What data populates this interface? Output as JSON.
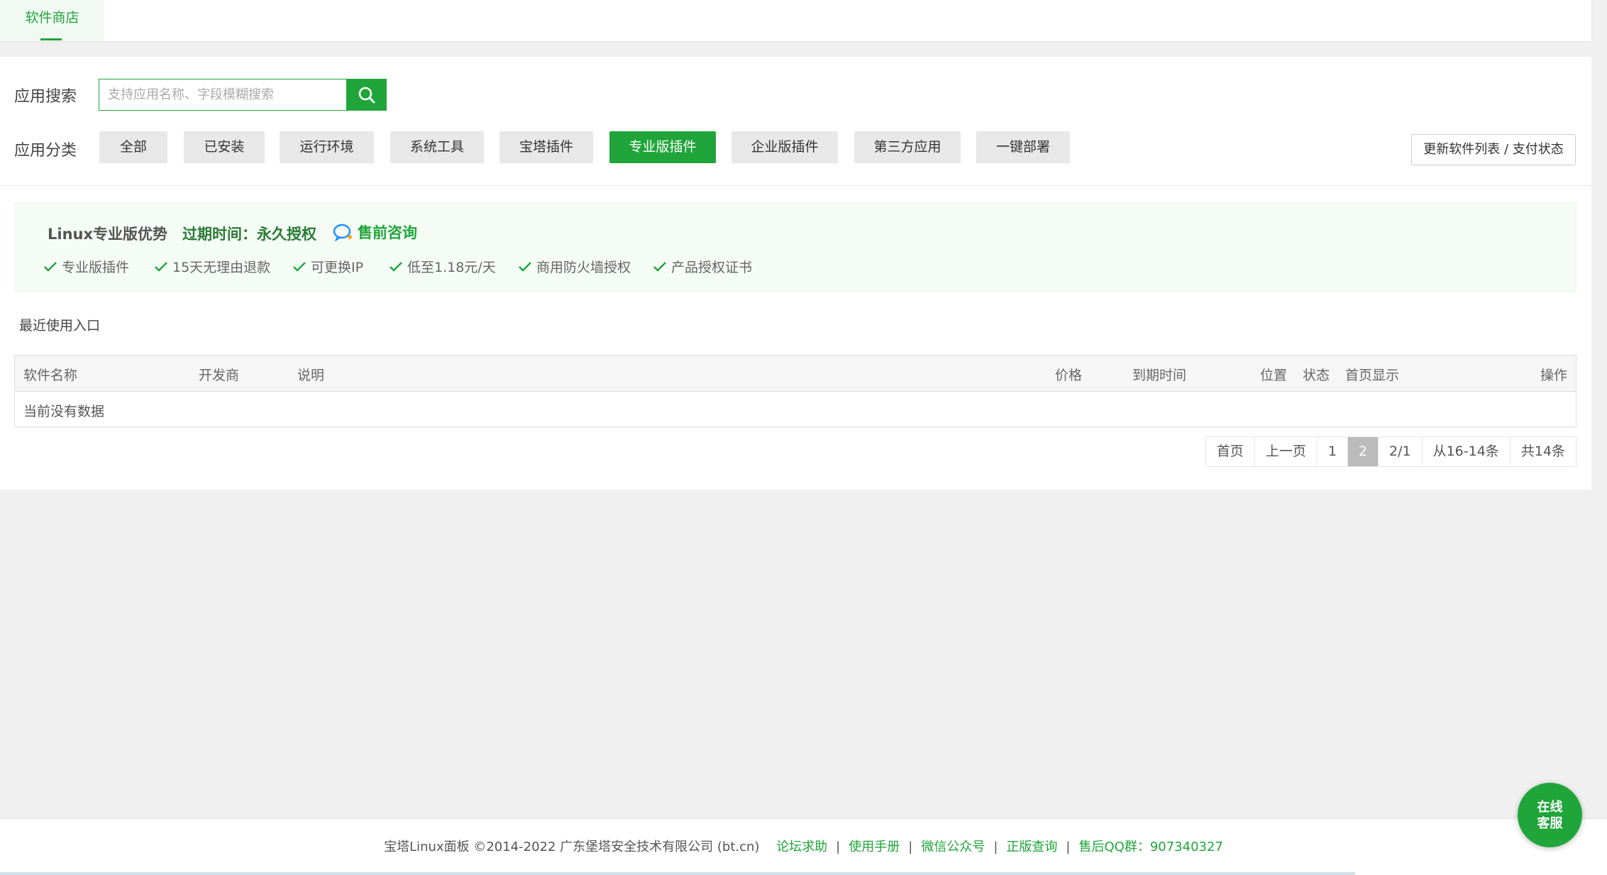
{
  "top_tab": {
    "label": "软件商店"
  },
  "search": {
    "label": "应用搜索",
    "placeholder": "支持应用名称、字段模糊搜索",
    "button_icon": "search-icon"
  },
  "categories": {
    "label": "应用分类",
    "items": [
      {
        "label": "全部",
        "active": false
      },
      {
        "label": "已安装",
        "active": false
      },
      {
        "label": "运行环境",
        "active": false
      },
      {
        "label": "系统工具",
        "active": false
      },
      {
        "label": "宝塔插件",
        "active": false
      },
      {
        "label": "专业版插件",
        "active": true
      },
      {
        "label": "企业版插件",
        "active": false
      },
      {
        "label": "第三方应用",
        "active": false
      },
      {
        "label": "一键部署",
        "active": false
      }
    ]
  },
  "refresh_button": {
    "label": "更新软件列表 / 支付状态"
  },
  "promo": {
    "title": "Linux专业版优势",
    "expire": "过期时间：永久授权",
    "consult": "售前咨询",
    "features": [
      "专业版插件",
      "15天无理由退款",
      "可更换IP",
      "低至1.18元/天",
      "商用防火墙授权",
      "产品授权证书"
    ]
  },
  "recent": {
    "label": "最近使用入口"
  },
  "table": {
    "columns": [
      "软件名称",
      "开发商",
      "说明",
      "价格",
      "到期时间",
      "位置",
      "状态",
      "首页显示",
      "操作"
    ],
    "empty_text": "当前没有数据"
  },
  "pagination": {
    "first": "首页",
    "prev": "上一页",
    "pages": [
      "1",
      "2"
    ],
    "current": "2",
    "page_info": "2/1",
    "range": "从16-14条",
    "total": "共14条"
  },
  "footer": {
    "copyright": "宝塔Linux面板 ©2014-2022 广东堡塔安全技术有限公司 (bt.cn)",
    "links": [
      "论坛求助",
      "使用手册",
      "微信公众号",
      "正版查询"
    ],
    "qq": "售后QQ群：907340327",
    "separator": "|"
  },
  "chat": {
    "line1": "在线",
    "line2": "客服"
  },
  "colors": {
    "accent": "#20a53a",
    "background": "#f0f0f0"
  }
}
